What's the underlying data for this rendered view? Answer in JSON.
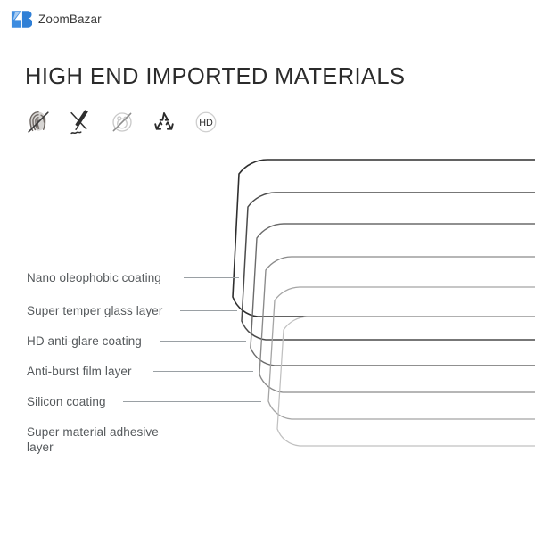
{
  "brand": {
    "name": "ZoomBazar",
    "mark_icon": "zb-monogram-icon",
    "mark_color": "#3d8ce0"
  },
  "headline": "HIGH END IMPORTED MATERIALS",
  "feature_icons": [
    {
      "name": "anti-fingerprint-icon",
      "label": "Anti-fingerprint"
    },
    {
      "name": "scratch-resistant-knife-icon",
      "label": "Scratch resistant"
    },
    {
      "name": "anti-glare-no-bubble-icon",
      "label": "Anti-glare"
    },
    {
      "name": "recyclable-icon",
      "label": "Recyclable"
    },
    {
      "name": "hd-clarity-icon",
      "label": "HD"
    }
  ],
  "hd_badge_text": "HD",
  "layers": [
    {
      "label": "Nano oleophobic coating",
      "stroke": "#2e2e2e"
    },
    {
      "label": "Super temper glass layer",
      "stroke": "#4a4a4a"
    },
    {
      "label": "HD anti-glare coating",
      "stroke": "#6b6b6b"
    },
    {
      "label": "Anti-burst film layer",
      "stroke": "#8a8a8a"
    },
    {
      "label": "Silicon coating",
      "stroke": "#a5a5a5"
    },
    {
      "label": "Super material adhesive\nlayer",
      "stroke": "#bdbdbd"
    }
  ],
  "colors": {
    "background": "#ffffff",
    "headline": "#2b2b2b",
    "label_text": "#55595c",
    "leader_line": "#9aa0a4"
  }
}
